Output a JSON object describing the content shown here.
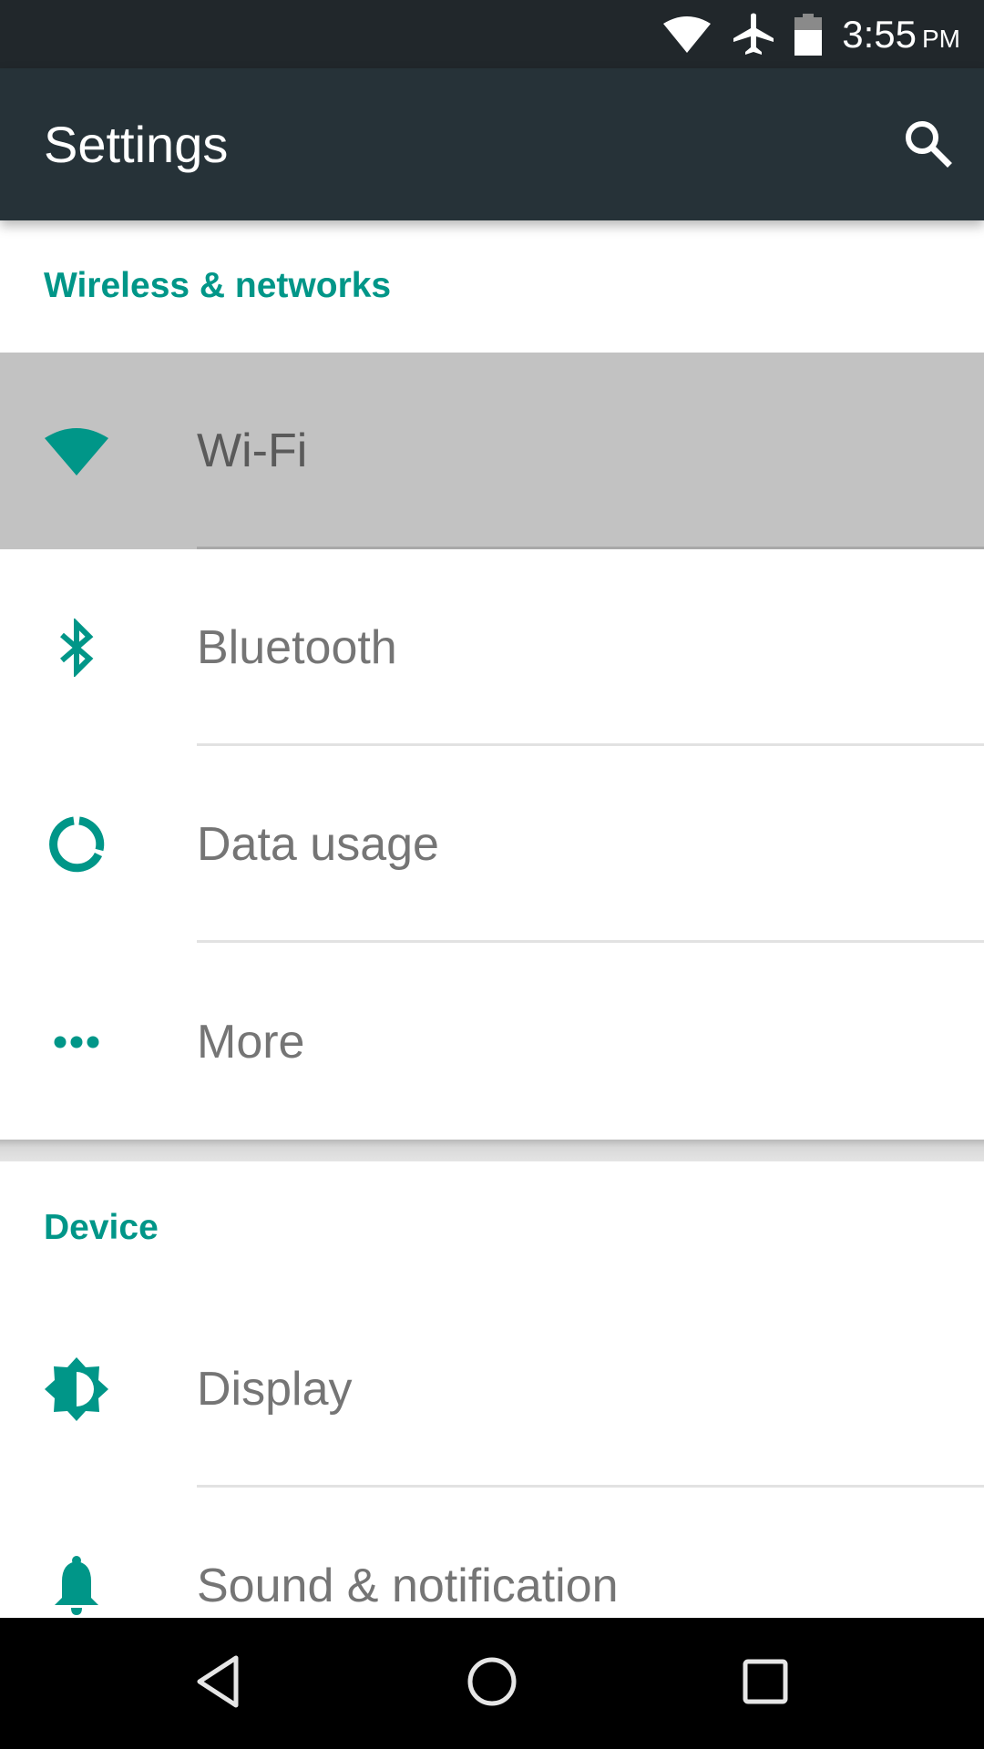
{
  "status_bar": {
    "time": "3:55",
    "ampm": "PM",
    "icons": [
      "wifi-icon",
      "airplane-mode-icon",
      "battery-icon"
    ]
  },
  "toolbar": {
    "title": "Settings",
    "search_icon": "search-icon"
  },
  "sections": [
    {
      "header": "Wireless & networks",
      "items": [
        {
          "label": "Wi-Fi",
          "icon": "wifi-icon",
          "pressed": true
        },
        {
          "label": "Bluetooth",
          "icon": "bluetooth-icon",
          "pressed": false
        },
        {
          "label": "Data usage",
          "icon": "data-usage-icon",
          "pressed": false
        },
        {
          "label": "More",
          "icon": "more-dots-icon",
          "pressed": false
        }
      ]
    },
    {
      "header": "Device",
      "items": [
        {
          "label": "Display",
          "icon": "brightness-icon",
          "pressed": false
        },
        {
          "label": "Sound & notification",
          "icon": "bell-icon",
          "pressed": false
        }
      ]
    }
  ],
  "nav_bar": {
    "buttons": [
      "back-icon",
      "home-icon",
      "recents-icon"
    ]
  },
  "colors": {
    "accent": "#009688",
    "toolbar": "#263238",
    "status_bar": "#21272b",
    "pressed_row": "#c2c2c2",
    "item_text": "#757575"
  }
}
